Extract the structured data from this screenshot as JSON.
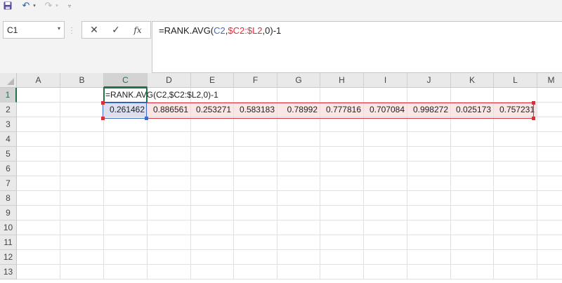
{
  "toolbar": {
    "save_icon": "save-icon",
    "undo_icon": "↶",
    "redo_icon": "↷",
    "dropdown_glyph": "▾",
    "customize_glyph": "▿"
  },
  "namebox": {
    "value": "C1",
    "dropdown_glyph": "▾"
  },
  "formula_buttons": {
    "cancel": "✕",
    "enter": "✓",
    "fx": "fx"
  },
  "formula_bar": {
    "parts": [
      {
        "text": "=RANK.AVG(",
        "role": "plain"
      },
      {
        "text": "C2",
        "role": "ref-c2"
      },
      {
        "text": ",",
        "role": "plain"
      },
      {
        "text": "$C2:$L2",
        "role": "ref-range"
      },
      {
        "text": ",0)-1",
        "role": "plain"
      }
    ]
  },
  "colors": {
    "selection_green": "#217346",
    "ref_blue": "#3f6cc4",
    "ref_red": "#d9303b",
    "range_fill": "#fbe6e6",
    "ref_fill": "#dcdff0"
  },
  "columns": [
    "A",
    "B",
    "C",
    "D",
    "E",
    "F",
    "G",
    "H",
    "I",
    "J",
    "K",
    "L",
    "M"
  ],
  "rows": [
    "1",
    "2",
    "3",
    "4",
    "5",
    "6",
    "7",
    "8",
    "9",
    "10",
    "11",
    "12",
    "13"
  ],
  "cells": {
    "C1": "=RANK.AVG(C2,$C2:$L2,0)-1",
    "row2": [
      "0.261462",
      "0.886561",
      "0.253271",
      "0.583183",
      "0.78992",
      "0.777816",
      "0.707084",
      "0.998272",
      "0.025173",
      "0.757231"
    ]
  },
  "active_cell": "C1"
}
